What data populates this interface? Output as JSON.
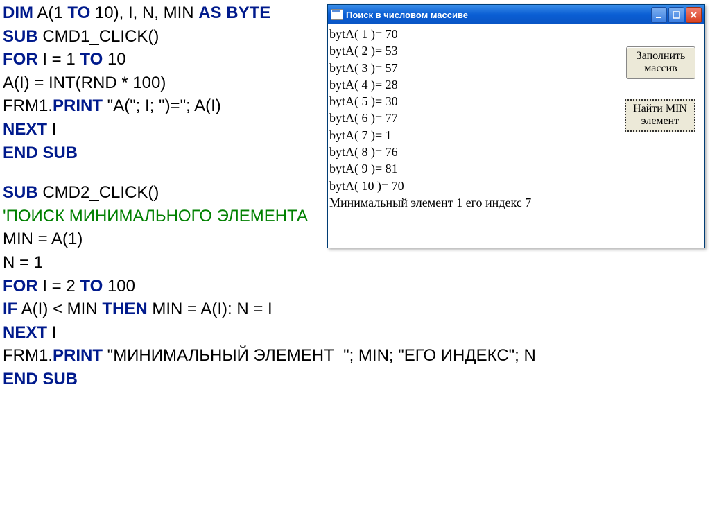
{
  "code": {
    "l1_a": "DIM",
    "l1_b": " A(1 ",
    "l1_c": "TO",
    "l1_d": " 10), I, N, MIN ",
    "l1_e": "AS BYTE",
    "l2_a": "SUB",
    "l2_b": " CMD1_CLICK()",
    "l3_a": "FOR",
    "l3_b": " I = 1 ",
    "l3_c": "TO",
    "l3_d": " 10",
    "l4": "A(I) = INT(RND * 100)",
    "l5_a": "FRM1.",
    "l5_b": "PRINT",
    "l5_c": " \"A(\"; I; \")=\"; A(I)",
    "l6_a": "NEXT",
    "l6_b": " I",
    "l7": "END SUB",
    "l8_a": "SUB",
    "l8_b": " CMD2_CLICK()",
    "l9": "'ПОИСК МИНИМАЛЬНОГО ЭЛЕМЕНТА",
    "l10": "MIN = A(1)",
    "l11": "N = 1",
    "l12_a": "FOR",
    "l12_b": " I = 2 ",
    "l12_c": "TO",
    "l12_d": " 100",
    "l13_a": "IF",
    "l13_b": " A(I) < MIN ",
    "l13_c": "THEN",
    "l13_d": " MIN = A(I): N = I",
    "l14_a": "NEXT",
    "l14_b": " I",
    "l15_a": "FRM1.",
    "l15_b": "PRINT",
    "l15_c": " \"МИНИМАЛЬНЫЙ ЭЛЕМЕНТ  \"; MIN; \"ЕГО ИНДЕКС\"; N",
    "l16": "END SUB"
  },
  "window": {
    "title": "Поиск в числовом массиве",
    "btn1_line1": "Заполнить",
    "btn1_line2": "массив",
    "btn2_line1": "Найти MIN",
    "btn2_line2": "элемент",
    "output": [
      "bytA( 1 )= 70",
      "bytA( 2 )= 53",
      "bytA( 3 )= 57",
      "bytA( 4 )= 28",
      "bytA( 5 )= 30",
      "bytA( 6 )= 77",
      "bytA( 7 )= 1",
      "bytA( 8 )= 76",
      "bytA( 9 )= 81",
      "bytA( 10 )= 70",
      "Минимальный элемент  1 его индекс 7"
    ]
  }
}
